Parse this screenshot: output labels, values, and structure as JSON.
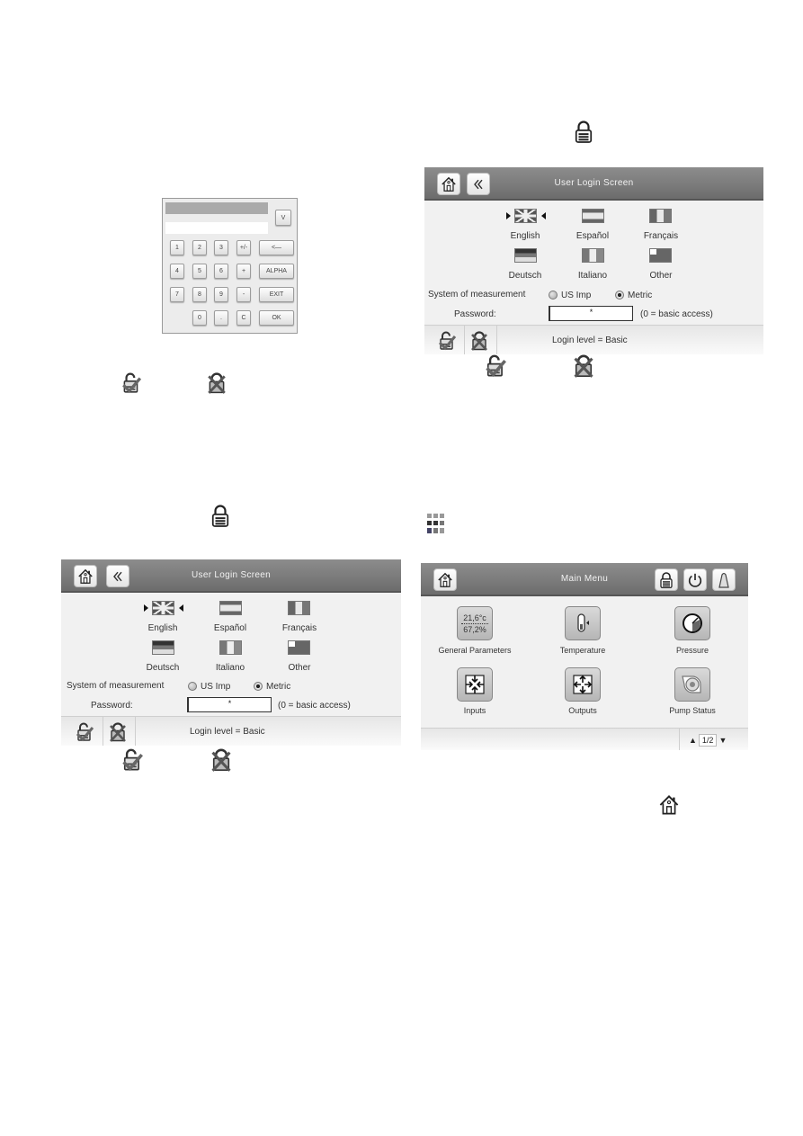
{
  "keypad": {
    "keys": [
      "1",
      "2",
      "3",
      "+/-",
      "<—",
      "4",
      "5",
      "6",
      "+",
      "ALPHA",
      "7",
      "8",
      "9",
      "-",
      "EXIT",
      "0",
      ".",
      "C",
      "OK"
    ],
    "v_button": "V"
  },
  "login_screen_1": {
    "title": "User Login Screen",
    "languages": [
      "English",
      "Español",
      "Français",
      "Deutsch",
      "Italiano",
      "Other"
    ],
    "selected_language": "English",
    "measurement_label": "System of measurement",
    "measurement_options": [
      "US Imp",
      "Metric"
    ],
    "measurement_selected": "Metric",
    "password_label": "Password:",
    "password_value": "*",
    "password_hint": "(0 = basic access)",
    "login_level": "Login level = Basic"
  },
  "login_screen_2": {
    "title": "User Login Screen",
    "languages": [
      "English",
      "Español",
      "Français",
      "Deutsch",
      "Italiano",
      "Other"
    ],
    "selected_language": "English",
    "measurement_label": "System of measurement",
    "measurement_options": [
      "US Imp",
      "Metric"
    ],
    "measurement_selected": "Metric",
    "password_label": "Password:",
    "password_value": "*",
    "password_hint": "(0 = basic access)",
    "login_level": "Login level = Basic"
  },
  "main_menu": {
    "title": "Main Menu",
    "general_params": {
      "temp": "21,6°c",
      "humidity": "67,2%"
    },
    "items": [
      "General Parameters",
      "Temperature",
      "Pressure",
      "Inputs",
      "Outputs",
      "Pump Status"
    ],
    "page": "1/2"
  },
  "icons": {
    "home": "home-icon",
    "back": "back-icon",
    "lock": "lock-icon",
    "login": "login-check-icon",
    "logout": "logout-x-icon",
    "power": "power-icon",
    "alarm": "alarm-bell-icon",
    "menu_grid": "menu-grid-icon"
  }
}
